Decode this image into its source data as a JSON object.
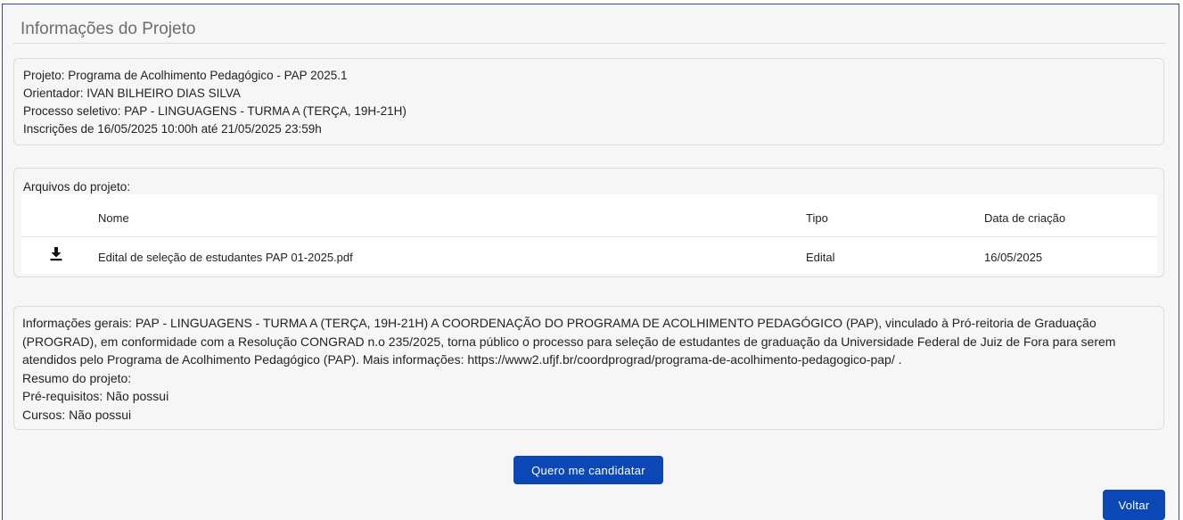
{
  "page": {
    "title": "Informações do Projeto"
  },
  "info": {
    "projeto": "Projeto: Programa de Acolhimento Pedagógico - PAP 2025.1",
    "orientador": "Orientador: IVAN BILHEIRO DIAS SILVA",
    "processo": "Processo seletivo: PAP - LINGUAGENS - TURMA A (TERÇA, 19H-21H)",
    "inscricoes": "Inscrições de 16/05/2025 10:00h até 21/05/2025 23:59h"
  },
  "files": {
    "label": "Arquivos do projeto:",
    "columns": {
      "name": "Nome",
      "type": "Tipo",
      "created": "Data de criação"
    },
    "rows": [
      {
        "icon": "download-icon",
        "name": "Edital de seleção de estudantes PAP 01-2025.pdf",
        "type": "Edital",
        "created": "16/05/2025"
      }
    ]
  },
  "general": {
    "info": "Informações gerais: PAP - LINGUAGENS - TURMA A (TERÇA, 19H-21H) A COORDENAÇÃO DO PROGRAMA DE ACOLHIMENTO PEDAGÓGICO (PAP), vinculado à Pró-reitoria de Graduação (PROGRAD), em conformidade com a Resolução CONGRAD n.o 235/2025, torna público o processo para seleção de estudantes de graduação da Universidade Federal de Juiz de Fora para serem atendidos pelo Programa de Acolhimento Pedagógico (PAP). Mais informações: https://www2.ufjf.br/coordprograd/programa-de-acolhimento-pedagogico-pap/ .",
    "resumo": "Resumo do projeto:",
    "prerequisitos": "Pré-requisitos:  Não possui",
    "cursos": "Cursos:  Não possui"
  },
  "actions": {
    "apply": "Quero me candidatar",
    "back": "Voltar"
  },
  "colors": {
    "primary": "#0b47b5",
    "frame_border": "#3b4a8c",
    "background": "#f6f6f6"
  }
}
